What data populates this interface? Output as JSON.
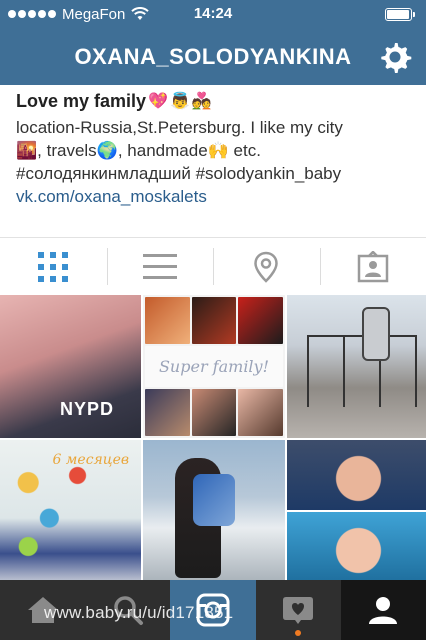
{
  "status": {
    "carrier": "MegaFon",
    "time": "14:24",
    "battery_level": 0.95
  },
  "header": {
    "username": "OXANA_SOLODYANKINA",
    "settings_icon": "gear-icon"
  },
  "bio": {
    "name": "Love my family",
    "name_emoji": [
      "💖",
      "👼",
      "💑"
    ],
    "line1": "location-Russia,St.Petersburg. I like my city",
    "line2_pre": "🌇, travels",
    "line2_emoji": "🌍",
    "line2_mid": ", handmade",
    "line2_emoji2": "🙌",
    "line2_post": " etc.",
    "line3": "#солодянкинмладший #solodyankin_baby",
    "link": "vk.com/oxana_moskalets"
  },
  "switcher": {
    "items": [
      "grid-view",
      "list-view",
      "map-view",
      "tagged-view"
    ],
    "active": "grid-view",
    "active_color": "#3a8fd0",
    "inactive_color": "#9a9a9a"
  },
  "photos": {
    "p1_text": "NYPD",
    "p2_text": "Super family!",
    "p4_text": "6 месяцев"
  },
  "tabbar": {
    "items": [
      "home-icon",
      "explore-icon",
      "camera-icon",
      "activity-icon",
      "profile-icon"
    ],
    "active": "profile-icon"
  },
  "watermark": "www.baby.ru/u/id171851"
}
